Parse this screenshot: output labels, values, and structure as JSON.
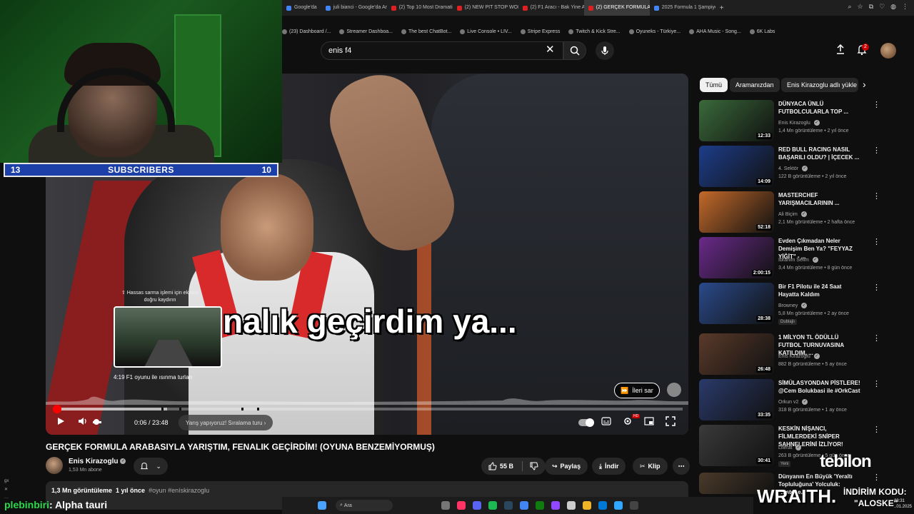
{
  "browser": {
    "tabs": [
      {
        "label": "Google'da",
        "active": false,
        "icon": "google"
      },
      {
        "label": "juli bianci - Google'da Ara",
        "active": false,
        "icon": "google"
      },
      {
        "label": "(2) Top 10 Most Dramatic",
        "active": false,
        "icon": "youtube"
      },
      {
        "label": "(2) NEW PIT STOP WOR",
        "active": false,
        "icon": "youtube"
      },
      {
        "label": "(2) F1 Aracı - Bak Yine Ar",
        "active": false,
        "icon": "youtube"
      },
      {
        "label": "(2) GERÇEK FORMULA A",
        "active": true,
        "icon": "youtube"
      },
      {
        "label": "2025 Formula 1 Şampiyo",
        "active": false,
        "icon": "google"
      }
    ],
    "new_tab": "+",
    "bookmarks": [
      "(23) Dashboard /...",
      "Streamer Dashboa...",
      "The best ChatBot...",
      "Live Console • LIV...",
      "Stripe Express",
      "Twitch & Kick Stre...",
      "Oyuneks - Türkiye...",
      "AHA Music - Song...",
      "6K Labs"
    ]
  },
  "header": {
    "search_value": "enis f4",
    "notification_count": "2"
  },
  "webcam": {
    "subs_left": "13",
    "subs_label": "SUBSCRIBERS",
    "subs_right": "10"
  },
  "player": {
    "caption": "nalık geçirdim ya...",
    "seek_hint": "⇧ Hassas sarma işlemi için ekrana doğru kaydırın",
    "preview_label": "4:19  F1 oyunu ile ısınma turları",
    "skip_label": "İleri sar",
    "time": "0:06 / 23:48",
    "chapter": "Yarış yapıyoruz! Sıralama turu",
    "progress_fraction": 0.004,
    "buffer_fraction": 0.18,
    "hover_fraction": 0.18
  },
  "video": {
    "title": "GERÇEK FORMULA ARABASIYLA YARIŞTIM, FENALIK GEÇİRDİM! (OYUNA BENZEMİYORMUŞ)",
    "channel": "Enis Kirazoglu",
    "subscribers": "1,53 Mn abone",
    "likes": "55 B",
    "share": "Paylaş",
    "download": "İndir",
    "clip": "Klip",
    "views": "1,3 Mn görüntüleme",
    "age": "1 yıl önce",
    "tags": "#oyun #enískirazoglu"
  },
  "chips": [
    "Tümü",
    "Aramanızdan",
    "Enis Kirazoglu adlı yükle"
  ],
  "recommendations": [
    {
      "title": "DÜNYACA ÜNLÜ FUTBOLCULARLA TOP ...",
      "channel": "Enis Kirazoglu",
      "meta": "1,4 Mn görüntüleme • 2 yıl önce",
      "duration": "12:33",
      "color": "#3a6a3a"
    },
    {
      "title": "RED BULL RACING NASIL BAŞARILI OLDU? | İÇECEK ...",
      "channel": "4. Sektör",
      "meta": "122 B görüntüleme • 2 yıl önce",
      "duration": "14:09",
      "color": "#1d3d8a"
    },
    {
      "title": "MASTERCHEF YARIŞMACILARININ ...",
      "channel": "Ali Biçim",
      "meta": "2,1 Mn görüntüleme • 2 hafta önce",
      "duration": "52:18",
      "color": "#c46a2a"
    },
    {
      "title": "Evden Çıkmadan Neler Demişim Ben Ya? \"FEYYAZ YİĞİT\" - ...",
      "channel": "İbrahim Selim",
      "meta": "3,4 Mn görüntüleme • 8 gün önce",
      "duration": "2:00:15",
      "color": "#6a2a8a"
    },
    {
      "title": "Bir F1 Pilotu ile 24 Saat Hayatta Kaldım",
      "channel": "Browney",
      "meta": "5,8 Mn görüntüleme • 2 ay önce",
      "badge": "Dublajlı",
      "duration": "28:38",
      "color": "#2a4a8a"
    },
    {
      "title": "1 MİLYON TL ÖDÜLLÜ FUTBOL TURNUVASINA KATILDIM, ...",
      "channel": "Enis Kirazoglu",
      "meta": "882 B görüntüleme • 5 ay önce",
      "duration": "26:48",
      "color": "#5a3a2a"
    },
    {
      "title": "SİMÜLASYONDAN PİSTLERE! @Cem Bolukbasi  ile #OrkCast",
      "channel": "Orkun v2",
      "meta": "318 B görüntüleme • 1 ay önce",
      "duration": "33:35",
      "color": "#2a3a6a"
    },
    {
      "title": "KESKİN NİŞANCI, FİLMLERDEKİ SNİPER SAHNELERİNİ İZLİYOR!",
      "channel": "Literat",
      "meta": "263 B görüntüleme • 5 gün önce",
      "badge": "Yeni",
      "duration": "30:41",
      "color": "#3a3a3a"
    },
    {
      "title": "Dünyanın En Büyük 'Yeraltı Topluluğuna' Yolculuk: Köstebe...",
      "channel": "",
      "meta": "",
      "duration": "",
      "color": "#4a3a2a"
    }
  ],
  "overlay": {
    "chat_user": "plebinbiri",
    "chat_msg": ": Alpha tauri",
    "sidebar_mini": "gx\n✕\n···",
    "tebilon": "tebilon",
    "wraith": "WRAITH.",
    "discount": "İNDİRİM KODU:",
    "code": "\"ALOSKE\"",
    "clock_time": "23:31",
    "clock_date": "..01.2025"
  },
  "taskbar": {
    "search": "Ara"
  },
  "colors": {
    "youtube_red": "#ff0000",
    "background": "#0f0f0f",
    "subs_bar": "#1d3fa8",
    "chat_user": "#2bd94a"
  }
}
